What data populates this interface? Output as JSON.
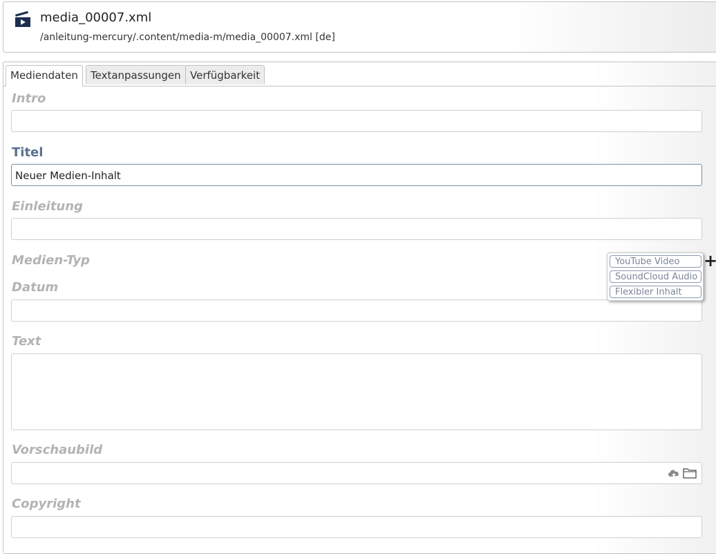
{
  "header": {
    "title": "media_00007.xml",
    "path": "/anleitung-mercury/.content/media-m/media_00007.xml [de]",
    "icon": "media-content-icon"
  },
  "tabs": [
    {
      "label": "Mediendaten",
      "active": true
    },
    {
      "label": "Textanpassungen",
      "active": false
    },
    {
      "label": "Verfügbarkeit",
      "active": false
    }
  ],
  "fields": {
    "intro": {
      "label": "Intro",
      "value": ""
    },
    "titel": {
      "label": "Titel",
      "value": "Neuer Medien-Inhalt"
    },
    "einleitung": {
      "label": "Einleitung",
      "value": ""
    },
    "medientyp": {
      "label": "Medien-Typ"
    },
    "datum": {
      "label": "Datum",
      "value": ""
    },
    "text": {
      "label": "Text",
      "value": ""
    },
    "vorschaubild": {
      "label": "Vorschaubild",
      "value": ""
    },
    "copyright": {
      "label": "Copyright",
      "value": ""
    }
  },
  "medientyp_choices": [
    "YouTube Video",
    "SoundCloud Audio",
    "Flexibler Inhalt"
  ],
  "colors": {
    "active_label": "#5a6f8e",
    "inactive_label": "#b3b3b3",
    "choice_border": "#8a98b3",
    "icon_dark": "#1c2d4f"
  }
}
